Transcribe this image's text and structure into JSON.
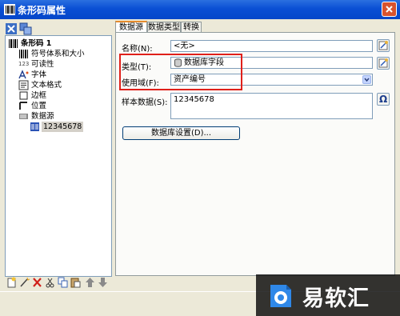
{
  "window": {
    "title": "条形码属性"
  },
  "tree": {
    "root": {
      "label": "条形码 1",
      "icon": "barcode-icon"
    },
    "items": [
      {
        "label": "符号体系和大小",
        "icon": "barcode-icon"
      },
      {
        "label": "可读性",
        "icon": "readability-icon",
        "prefix": "123"
      },
      {
        "label": "字体",
        "icon": "font-icon"
      },
      {
        "label": "文本格式",
        "icon": "text-format-icon"
      },
      {
        "label": "边框",
        "icon": "border-icon"
      },
      {
        "label": "位置",
        "icon": "position-icon"
      },
      {
        "label": "数据源",
        "icon": "datasource-icon"
      }
    ],
    "child": {
      "label": "12345678",
      "icon": "data-item-icon"
    }
  },
  "tabs": [
    {
      "label": "数据源",
      "active": true
    },
    {
      "label": "数据类型",
      "active": false
    },
    {
      "label": "转换",
      "active": false
    }
  ],
  "form": {
    "name_label": "名称(N):",
    "name_value": "<无>",
    "type_label": "类型(T):",
    "type_value": "数据库字段",
    "use_field_label": "使用域(F):",
    "use_field_value": "资产编号",
    "sample_label": "样本数据(S):",
    "sample_value": "12345678",
    "db_settings_button": "数据库设置(D)..."
  },
  "watermark": {
    "text": "易软汇"
  },
  "colors": {
    "title_bar": "#0A4FD4",
    "highlight_box": "#E0201A",
    "tab_accent": "#E68B2C"
  }
}
